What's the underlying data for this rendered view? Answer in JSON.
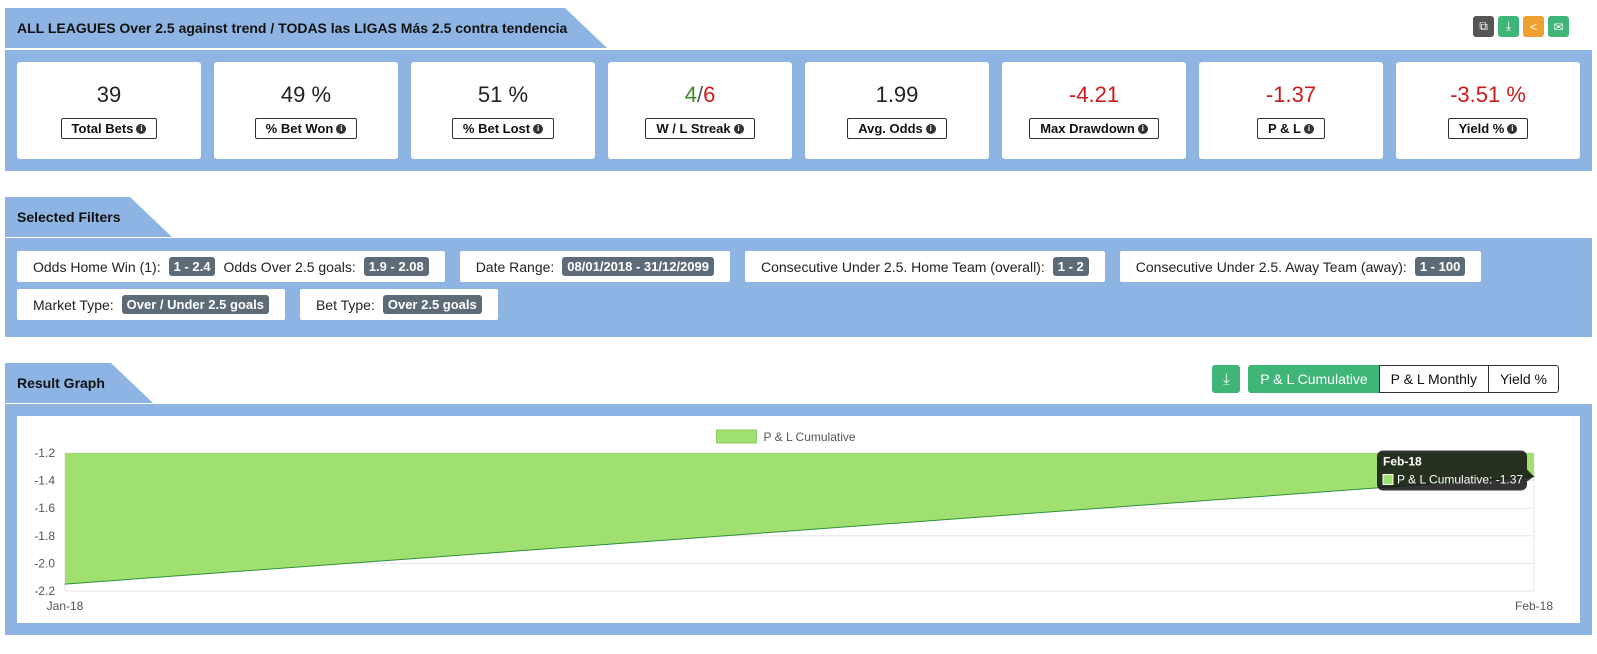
{
  "header": {
    "title": "ALL LEAGUES Over 2.5 against trend / TODAS las LIGAS Más 2.5 contra tendencia"
  },
  "toolbar": {
    "buttons": [
      {
        "icon": "copy-icon",
        "color": "#555555"
      },
      {
        "icon": "download-icon",
        "color": "#3fb578"
      },
      {
        "icon": "share-icon",
        "color": "#f0a030"
      },
      {
        "icon": "email-icon",
        "color": "#3fb578"
      }
    ]
  },
  "stats": {
    "total_bets": {
      "value": "39",
      "label": "Total Bets"
    },
    "bet_won": {
      "value": "49 %",
      "label": "% Bet Won"
    },
    "bet_lost": {
      "value": "51 %",
      "label": "% Bet Lost"
    },
    "streak": {
      "win": "4",
      "sep": "/",
      "loss": "6",
      "label": "W / L Streak"
    },
    "avg_odds": {
      "value": "1.99",
      "label": "Avg. Odds"
    },
    "max_drawdown": {
      "value": "-4.21",
      "label": "Max Drawdown"
    },
    "pl": {
      "value": "-1.37",
      "label": "P & L"
    },
    "yield": {
      "value": "-3.51 %",
      "label": "Yield %"
    }
  },
  "filters": {
    "title": "Selected Filters",
    "odds_home_win": {
      "label": "Odds Home Win (1):",
      "value": "1 - 2.4"
    },
    "odds_over": {
      "label": "Odds Over 2.5 goals:",
      "value": "1.9 - 2.08"
    },
    "date_range": {
      "label": "Date Range:",
      "value": "08/01/2018 - 31/12/2099"
    },
    "consec_home": {
      "label": "Consecutive Under 2.5. Home Team (overall):",
      "value": "1 - 2"
    },
    "consec_away": {
      "label": "Consecutive Under 2.5. Away Team (away):",
      "value": "1 - 100"
    },
    "market_type": {
      "label": "Market Type:",
      "value": "Over / Under 2.5 goals"
    },
    "bet_type": {
      "label": "Bet Type:",
      "value": "Over 2.5 goals"
    }
  },
  "graph": {
    "title": "Result Graph",
    "tabs": {
      "cumulative": "P & L Cumulative",
      "monthly": "P & L Monthly",
      "yield": "Yield %"
    }
  },
  "chart_data": {
    "type": "area",
    "categories": [
      "Jan-18",
      "Feb-18"
    ],
    "series": [
      {
        "name": "P & L Cumulative",
        "values": [
          -2.15,
          -1.37
        ],
        "color": "#a0e070"
      }
    ],
    "ylim": [
      -2.2,
      -1.2
    ],
    "yticks": [
      "-1.2",
      "-1.4",
      "-1.6",
      "-1.8",
      "-2.0",
      "-2.2"
    ],
    "legend": "top-center",
    "tooltip": {
      "title": "Feb-18",
      "text": "P & L Cumulative: -1.37"
    }
  }
}
